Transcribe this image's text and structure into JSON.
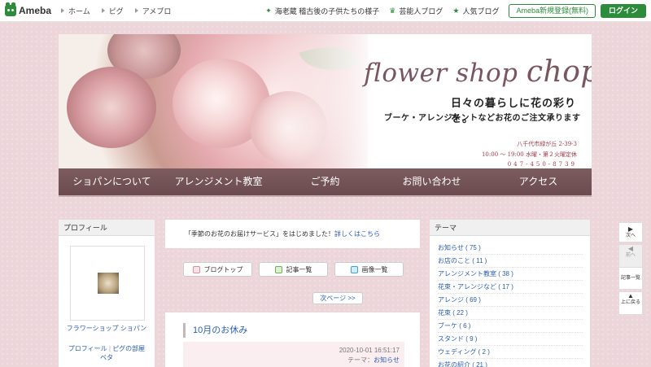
{
  "topbar": {
    "logo_text": "Ameba",
    "nav": [
      "ホーム",
      "ピグ",
      "アメブロ"
    ],
    "right_links": [
      {
        "icon": "✦",
        "label": "海老蔵 稽古後の子供たちの様子"
      },
      {
        "icon": "♛",
        "label": "芸能人ブログ"
      },
      {
        "icon": "★",
        "label": "人気ブログ"
      }
    ],
    "register_label": "Ameba新規登録(無料)",
    "login_label": "ログイン"
  },
  "banner": {
    "shop_title_1": "flower shop ",
    "shop_title_2": "chopin",
    "tagline1": "日々の暮らしに花の彩りを。",
    "tagline2": "ブーケ・アレンジメントなどお花のご注文承ります",
    "addr1": "八千代市緑が丘 2-39-3",
    "addr2": "10:00 〜 19:00  水曜・第２火曜定休",
    "addr3": "047-450-8739",
    "menu": [
      "ショパンについて",
      "アレンジメント教室",
      "ご予約",
      "お問い合わせ",
      "アクセス"
    ]
  },
  "profile": {
    "title": "プロフィール",
    "name": "フラワーショップ ショパン",
    "link_profile": "プロフィール",
    "link_pig": "ピグの部屋",
    "link_beta": "ベタ"
  },
  "notice": {
    "text": "「季節のお花のお届けサービス」をはじめました！",
    "link": "詳しくはこちら"
  },
  "buttons": {
    "blog_top": "ブログトップ",
    "articles": "記事一覧",
    "images": "画像一覧",
    "next_page": "次ページ >>"
  },
  "article": {
    "title": "10月のお休み",
    "date": "2020-10-01 16:51:17",
    "theme_label": "テーマ：",
    "theme_value": "お知らせ"
  },
  "themes": {
    "title": "テーマ",
    "items": [
      "お知らせ ( 75 )",
      "お店のこと ( 11 )",
      "アレンジメント教室 ( 38 )",
      "花束・アレンジなど ( 17 )",
      "アレンジ ( 69 )",
      "花束 ( 22 )",
      "ブーケ ( 6 )",
      "スタンド ( 9 )",
      "ウェディング ( 2 )",
      "お花の紹介 ( 21 )"
    ]
  },
  "sidenav": {
    "next": "次へ",
    "prev": "前へ",
    "articles": "記事一覧",
    "top": "上に戻る"
  }
}
